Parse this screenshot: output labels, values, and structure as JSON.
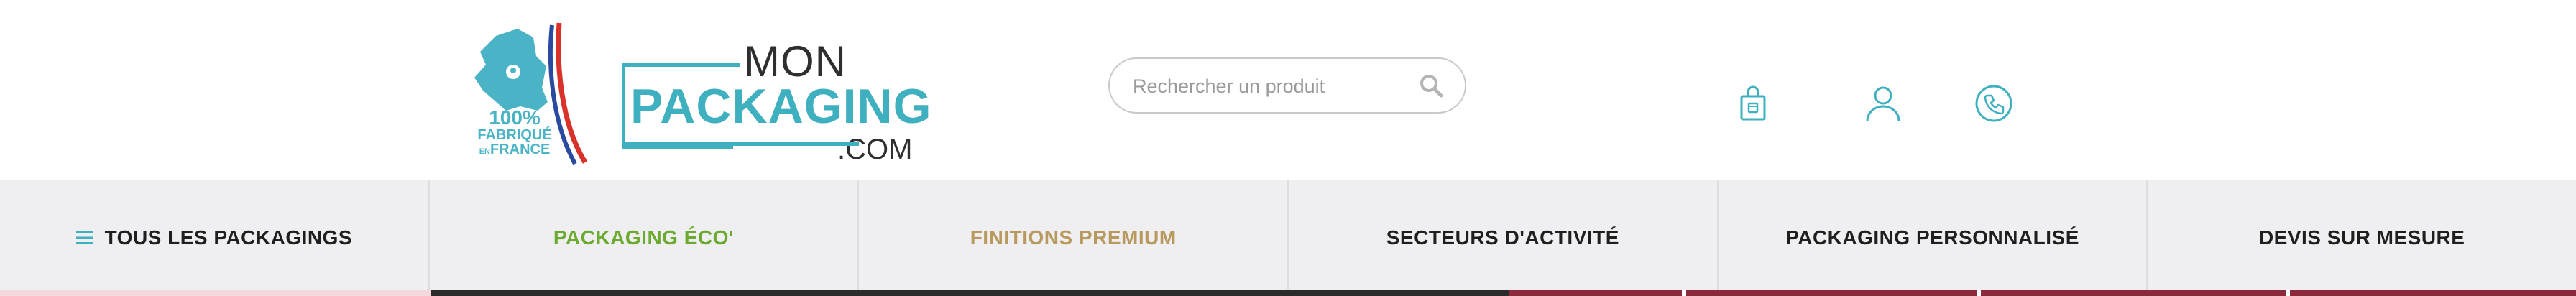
{
  "logo": {
    "badge_percent": "100%",
    "badge_line1": "FABRIQUÉ",
    "badge_line2_small": "EN",
    "badge_line2": "FRANCE",
    "brand_top": "MON",
    "brand_main": "PACKAGING",
    "brand_suffix": ".COM"
  },
  "search": {
    "placeholder": "Rechercher un produit",
    "value": ""
  },
  "header_icons": [
    {
      "name": "shopping-bag-icon"
    },
    {
      "name": "user-account-icon"
    },
    {
      "name": "phone-icon"
    }
  ],
  "nav": {
    "items": [
      {
        "label": "TOUS LES PACKAGINGS",
        "color": "#1f1f1f"
      },
      {
        "label": "PACKAGING ÉCO'",
        "color": "#6aaa2e"
      },
      {
        "label": "FINITIONS PREMIUM",
        "color": "#b89a5f"
      },
      {
        "label": "SECTEURS D'ACTIVITÉ",
        "color": "#1f1f1f"
      },
      {
        "label": "PACKAGING PERSONNALISÉ",
        "color": "#1f1f1f"
      },
      {
        "label": "DEVIS SUR MESURE",
        "color": "#1f1f1f"
      }
    ]
  },
  "colors": {
    "brand_teal": "#3fb0c0",
    "flag_red": "#d9322b",
    "flag_blue": "#2a4aa0",
    "nav_bg": "#efeef0",
    "eco_green": "#6aaa2e",
    "premium_gold": "#b89a5f"
  }
}
